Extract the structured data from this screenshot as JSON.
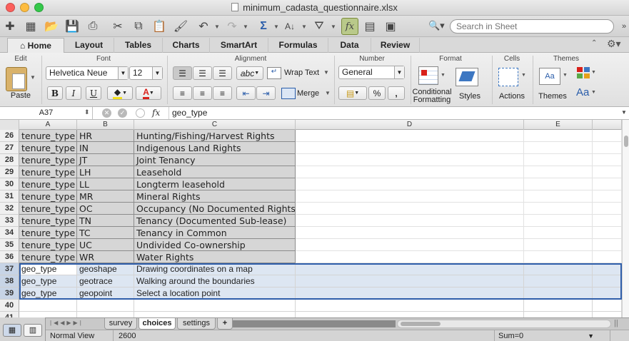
{
  "window": {
    "title": "minimum_cadasta_questionnaire.xlsx",
    "traffic_lights": {
      "close": "#fc605c",
      "minimize": "#fdbc40",
      "zoom": "#34c84a"
    }
  },
  "toolbar": {
    "icons": [
      "new-workbook-icon",
      "templates-icon",
      "open-icon",
      "save-icon",
      "print-icon",
      "cut-icon",
      "copy-icon",
      "paste-icon",
      "format-painter-icon",
      "undo-icon",
      "redo-icon",
      "autosum-icon",
      "sort-icon",
      "filter-icon",
      "formula-builder-icon",
      "gallery-icon",
      "toolbox-icon"
    ],
    "fx_label": "fx",
    "search_placeholder": "Search in Sheet"
  },
  "ribbon_tabs": [
    "Home",
    "Layout",
    "Tables",
    "Charts",
    "SmartArt",
    "Formulas",
    "Data",
    "Review"
  ],
  "ribbon": {
    "groups": {
      "edit": "Edit",
      "font": "Font",
      "alignment": "Alignment",
      "number": "Number",
      "format": "Format",
      "cells": "Cells",
      "themes": "Themes"
    },
    "paste_label": "Paste",
    "font_name": "Helvetica Neue",
    "font_size": "12",
    "bold": "B",
    "italic": "I",
    "underline": "U",
    "abc": "abc",
    "wrap_text": "Wrap Text",
    "merge": "Merge",
    "number_format": "General",
    "percent": "%",
    "comma": ",",
    "conditional_formatting_1": "Conditional",
    "conditional_formatting_2": "Formatting",
    "styles": "Styles",
    "actions": "Actions",
    "themes": "Themes",
    "theme_font": "Aa",
    "accent_color": "#3d77c2",
    "font_color": "#d8201a"
  },
  "formula_bar": {
    "name_box": "A37",
    "fx": "fx",
    "content": "geo_type"
  },
  "columns": [
    "A",
    "B",
    "C",
    "D",
    "E"
  ],
  "rows": [
    {
      "num": "26",
      "a": "tenure_type",
      "b": "HR",
      "c": "Hunting/Fishing/Harvest Rights"
    },
    {
      "num": "27",
      "a": "tenure_type",
      "b": "IN",
      "c": "Indigenous Land Rights"
    },
    {
      "num": "28",
      "a": "tenure_type",
      "b": "JT",
      "c": "Joint Tenancy"
    },
    {
      "num": "29",
      "a": "tenure_type",
      "b": "LH",
      "c": "Leasehold"
    },
    {
      "num": "30",
      "a": "tenure_type",
      "b": "LL",
      "c": "Longterm leasehold"
    },
    {
      "num": "31",
      "a": "tenure_type",
      "b": "MR",
      "c": "Mineral Rights"
    },
    {
      "num": "32",
      "a": "tenure_type",
      "b": "OC",
      "c": "Occupancy (No Documented Rights)"
    },
    {
      "num": "33",
      "a": "tenure_type",
      "b": "TN",
      "c": "Tenancy (Documented Sub-lease)"
    },
    {
      "num": "34",
      "a": "tenure_type",
      "b": "TC",
      "c": "Tenancy in Common"
    },
    {
      "num": "35",
      "a": "tenure_type",
      "b": "UC",
      "c": "Undivided Co-ownership"
    },
    {
      "num": "36",
      "a": "tenure_type",
      "b": "WR",
      "c": "Water Rights"
    },
    {
      "num": "37",
      "a": "geo_type",
      "b": "geoshape",
      "c": "Drawing coordinates on a map"
    },
    {
      "num": "38",
      "a": "geo_type",
      "b": "geotrace",
      "c": "Walking around the boundaries"
    },
    {
      "num": "39",
      "a": "geo_type",
      "b": "geopoint",
      "c": "Select a location point"
    },
    {
      "num": "40",
      "a": "",
      "b": "",
      "c": ""
    },
    {
      "num": "41",
      "a": "",
      "b": "",
      "c": ""
    }
  ],
  "sheet_tabs": [
    "survey",
    "choices",
    "settings"
  ],
  "add_sheet": "+",
  "status": {
    "view": "Normal View",
    "count": "2600",
    "sum": "Sum=0"
  }
}
